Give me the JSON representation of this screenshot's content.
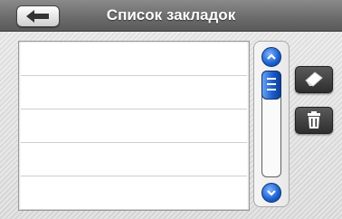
{
  "header": {
    "title": "Список закладок"
  },
  "icons": {
    "back": "back-arrow-icon",
    "edit": "eraser-icon",
    "delete": "trash-icon",
    "scroll_up": "chevron-up-icon",
    "scroll_down": "chevron-down-icon"
  },
  "bookmarks": {
    "items": [
      "",
      "",
      "",
      "",
      ""
    ]
  },
  "scrollbar": {
    "position": 0
  },
  "colors": {
    "accent": "#1a5fd0",
    "titlebar": "#6a6a6a",
    "buttons": "#2e2e2e"
  }
}
